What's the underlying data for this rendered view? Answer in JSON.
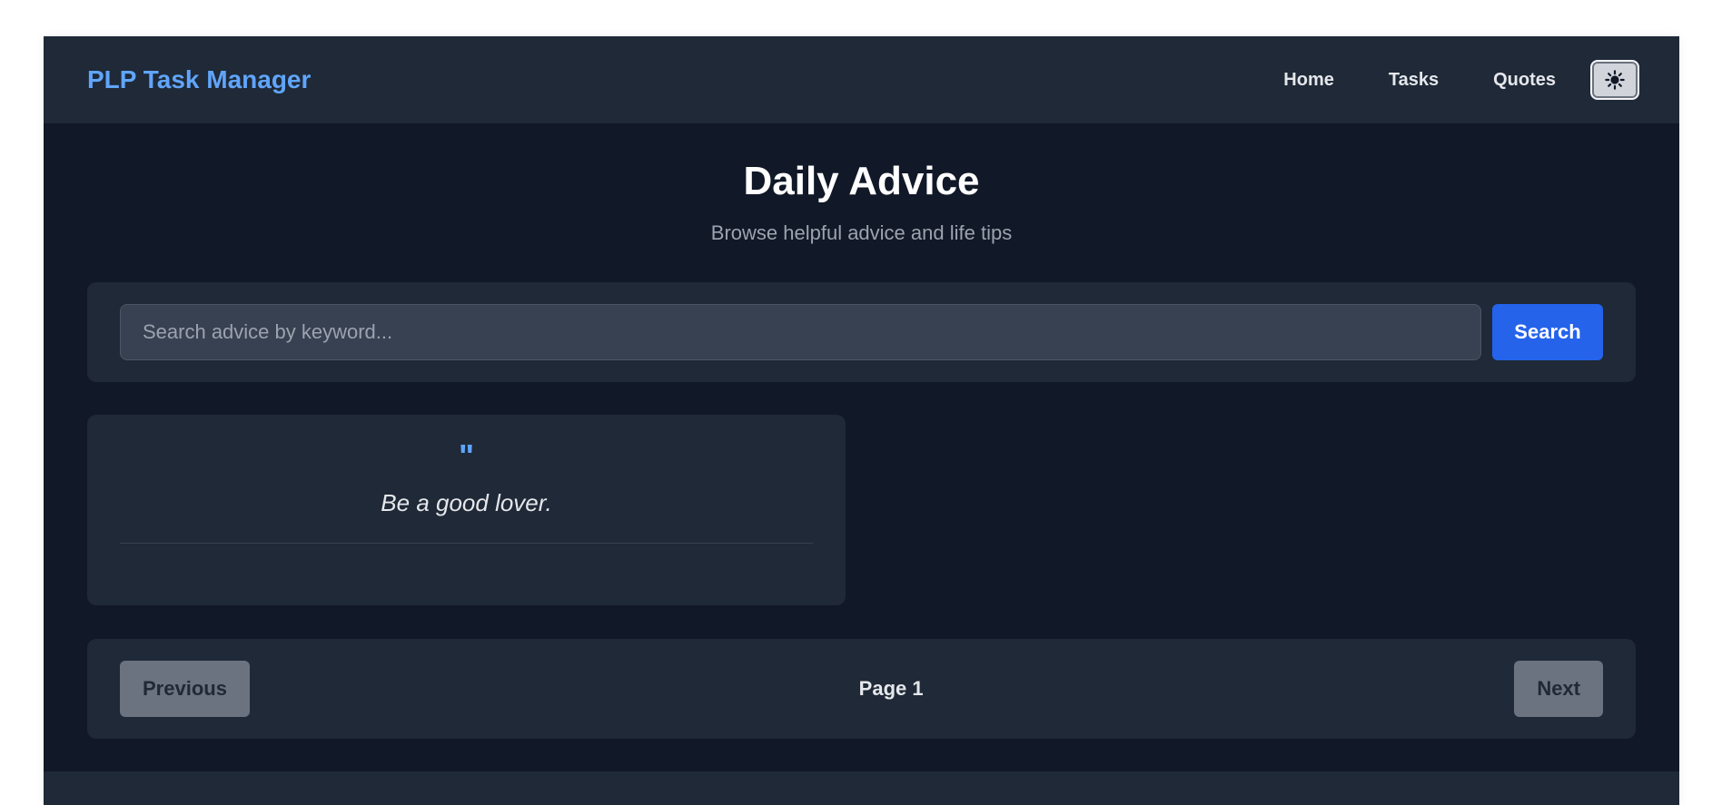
{
  "navbar": {
    "brand": "PLP Task Manager",
    "links": [
      "Home",
      "Tasks",
      "Quotes"
    ],
    "theme_toggle_icon": "sun-icon"
  },
  "hero": {
    "title": "Daily Advice",
    "subtitle": "Browse helpful advice and life tips"
  },
  "search": {
    "placeholder": "Search advice by keyword...",
    "value": "",
    "button_label": "Search"
  },
  "advice_cards": [
    {
      "quote_mark": "\"",
      "text": "Be a good lover."
    }
  ],
  "pagination": {
    "previous_label": "Previous",
    "page_label": "Page 1",
    "next_label": "Next"
  },
  "colors": {
    "accent": "#60a5fa",
    "primary_button": "#2563eb",
    "background": "#111827",
    "panel": "#1f2937"
  }
}
